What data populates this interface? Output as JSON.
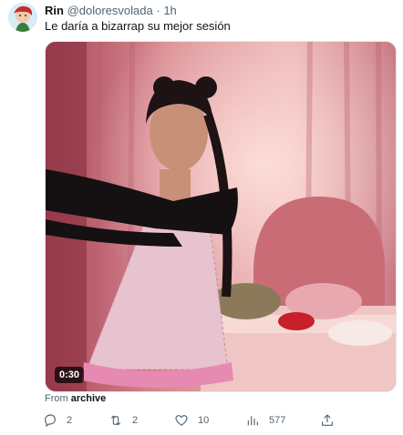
{
  "tweet": {
    "author_name": "Rin",
    "author_handle": "@doloresvolada",
    "separator": "·",
    "time": "1h",
    "text": "Le daría a bizarrap su mejor sesión",
    "media": {
      "type": "video",
      "duration": "0:30"
    },
    "source_prefix": "From",
    "source_name": "archive",
    "actions": {
      "replies": "2",
      "retweets": "2",
      "likes": "10",
      "views": "577"
    }
  },
  "colors": {
    "text_primary": "#0f1419",
    "text_secondary": "#536471",
    "background": "#ffffff"
  }
}
